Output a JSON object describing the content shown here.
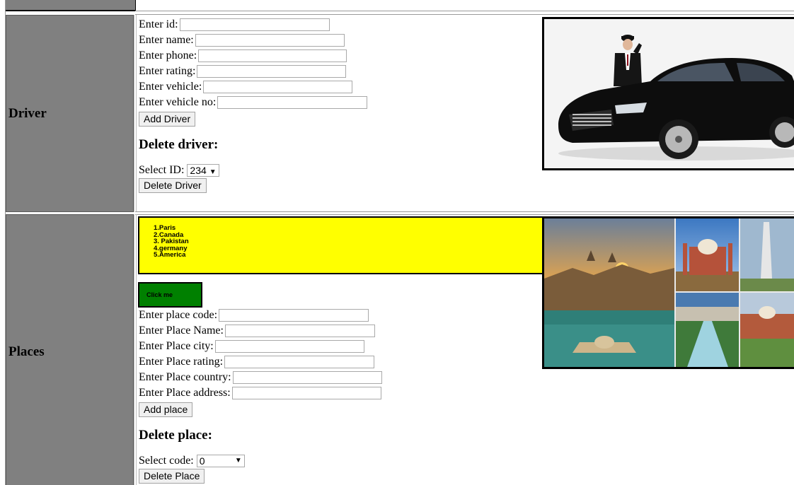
{
  "driver": {
    "label": "Driver",
    "fields": [
      {
        "label": "Enter id:",
        "value": ""
      },
      {
        "label": "Enter name:",
        "value": ""
      },
      {
        "label": "Enter phone:",
        "value": ""
      },
      {
        "label": "Enter rating:",
        "value": ""
      },
      {
        "label": "Enter vehicle:",
        "value": ""
      },
      {
        "label": "Enter vehicle no:",
        "value": ""
      }
    ],
    "add_button": "Add Driver",
    "delete_heading": "Delete driver:",
    "select_label": "Select ID:",
    "select_value": "234",
    "delete_button": "Delete Driver"
  },
  "places": {
    "label": "Places",
    "list": [
      "1.Paris",
      "2.Canada",
      "3. Pakistan",
      "4.germany",
      "5.America"
    ],
    "click_button": "Click me",
    "fields": [
      {
        "label": "Enter place code:",
        "value": ""
      },
      {
        "label": "Enter Place Name:",
        "value": ""
      },
      {
        "label": "Enter Place city:",
        "value": ""
      },
      {
        "label": "Enter Place rating:",
        "value": ""
      },
      {
        "label": "Enter Place country:",
        "value": ""
      },
      {
        "label": "Enter Place address:",
        "value": ""
      }
    ],
    "add_button": "Add place",
    "delete_heading": "Delete place:",
    "select_label": "Select code:",
    "select_value": "0",
    "delete_button": "Delete Place"
  },
  "colors": {
    "label_bg": "#808080",
    "yellow": "#ffff00",
    "green": "#008000"
  },
  "icons": {
    "select_caret": "▼"
  }
}
